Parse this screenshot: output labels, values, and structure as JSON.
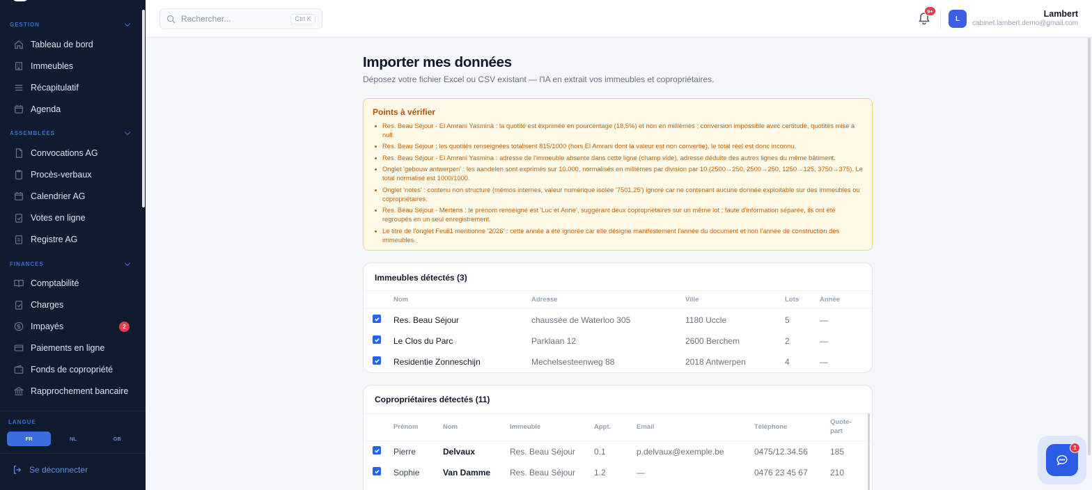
{
  "sidebar": {
    "sections": [
      {
        "label": "GESTION"
      },
      {
        "label": "ASSEMBLÉES"
      },
      {
        "label": "FINANCES"
      }
    ],
    "items": [
      {
        "label": "Tableau de bord",
        "icon": "home-icon"
      },
      {
        "label": "Immeubles",
        "icon": "building-icon"
      },
      {
        "label": "Récapitulatif",
        "icon": "list-icon"
      },
      {
        "label": "Agenda",
        "icon": "calendar-icon"
      },
      {
        "label": "Convocations AG",
        "icon": "document-icon"
      },
      {
        "label": "Procès-verbaux",
        "icon": "clipboard-icon"
      },
      {
        "label": "Calendrier AG",
        "icon": "calendar-icon"
      },
      {
        "label": "Votes en ligne",
        "icon": "clipboard-check-icon"
      },
      {
        "label": "Registre AG",
        "icon": "clipboard-icon"
      },
      {
        "label": "Comptabilité",
        "icon": "book-icon"
      },
      {
        "label": "Charges",
        "icon": "clipboard-check-icon"
      },
      {
        "label": "Impayés",
        "icon": "coin-icon",
        "badge": "2"
      },
      {
        "label": "Paiements en ligne",
        "icon": "card-icon"
      },
      {
        "label": "Fonds de copropriété",
        "icon": "wallet-icon"
      },
      {
        "label": "Rapprochement bancaire",
        "icon": "bank-icon"
      }
    ],
    "language": {
      "title": "LANGUE",
      "options": [
        "FR",
        "NL",
        "GB"
      ],
      "selected": "FR"
    },
    "logout_label": "Se déconnecter"
  },
  "topbar": {
    "search_placeholder": "Rechercher...",
    "search_shortcut": "Ctrl K",
    "notification_badge": "9+",
    "avatar_initial": "L",
    "user_name": "Lambert",
    "user_email": "cabinet.lambert.demo@gmail.com"
  },
  "page": {
    "title": "Importer mes données",
    "subtitle": "Déposez votre fichier Excel ou CSV existant — l'IA en extrait vos immeubles et copropriétaires."
  },
  "warnings": {
    "title": "Points à vérifier",
    "items": [
      "Res. Beau Séjour - El Amrani Yasmina : la quotité est exprimée en pourcentage (18,5%) et non en millièmes ; conversion impossible avec certitude, quotites mise à null.",
      "Res. Beau Séjour : les quotités renseignées totalisent 815/1000 (hors El Amrani dont la valeur est non convertie), le total réel est donc inconnu.",
      "Res. Beau Séjour - El Amrani Yasmina : adresse de l'immeuble absente dans cette ligne (champ vide), adresse déduite des autres lignes du même bâtiment.",
      "Onglet 'gebouw antwerpen' : les aandelen sont exprimés sur 10.000, normalisés en millièmes par division par 10 (2500→250, 2500→250, 1250→125, 3750→375). Le total normalisé est 1000/1000.",
      "Onglet 'notes' : contenu non structuré (mémos internes, valeur numérique isolée '7501,25') ignoré car ne contenant aucune donnée exploitable sur des immeubles ou copropriétaires.",
      "Res. Beau Séjour - Mertens : le prénom renseigné est 'Luc et Anne', suggérant deux copropriétaires sur un même lot ; faute d'information séparée, ils ont été regroupés en un seul enregistrement.",
      "Le titre de l'onglet Feuil1 mentionne '2026' : cette année a été ignorée car elle désigne manifestement l'année du document et non l'année de construction des immeubles."
    ]
  },
  "buildings": {
    "title": "Immeubles détectés (3)",
    "columns": [
      "Nom",
      "Adresse",
      "Ville",
      "Lots",
      "Année"
    ],
    "rows": [
      {
        "nom": "Res. Beau Séjour",
        "adresse": "chaussée de Waterloo 305",
        "ville": "1180 Uccle",
        "lots": "5",
        "annee": "—",
        "checked": true
      },
      {
        "nom": "Le Clos du Parc",
        "adresse": "Parklaan 12",
        "ville": "2600 Berchem",
        "lots": "2",
        "annee": "—",
        "checked": true
      },
      {
        "nom": "Residentie Zonneschijn",
        "adresse": "Mechelsesteenweg 88",
        "ville": "2018 Antwerpen",
        "lots": "4",
        "annee": "—",
        "checked": true
      }
    ]
  },
  "owners": {
    "title": "Copropriétaires détectés (11)",
    "columns": [
      "Prénom",
      "Nom",
      "Immeuble",
      "Appt.",
      "Email",
      "Téléphone",
      "Quote-",
      "part"
    ],
    "rows": [
      {
        "prenom": "Pierre",
        "nom": "Delvaux",
        "immeuble": "Res. Beau Séjour",
        "appt": "0.1",
        "email": "p.delvaux@exemple.be",
        "telephone": "0475/12.34.56",
        "quote": "185",
        "checked": true
      },
      {
        "prenom": "Sophie",
        "nom": "Van Damme",
        "immeuble": "Res. Beau Séjour",
        "appt": "1.2",
        "email": "—",
        "telephone": "0476 23 45 67",
        "quote": "210",
        "checked": true
      }
    ]
  },
  "chat": {
    "badge": "1",
    "icon": "chat-icon"
  },
  "colors": {
    "sidebar_bg": "#0f1b2e",
    "accent": "#2b5ce6",
    "badge": "#e53e4e",
    "warning_text": "#c2620a",
    "warning_bg": "#fff9e8"
  }
}
